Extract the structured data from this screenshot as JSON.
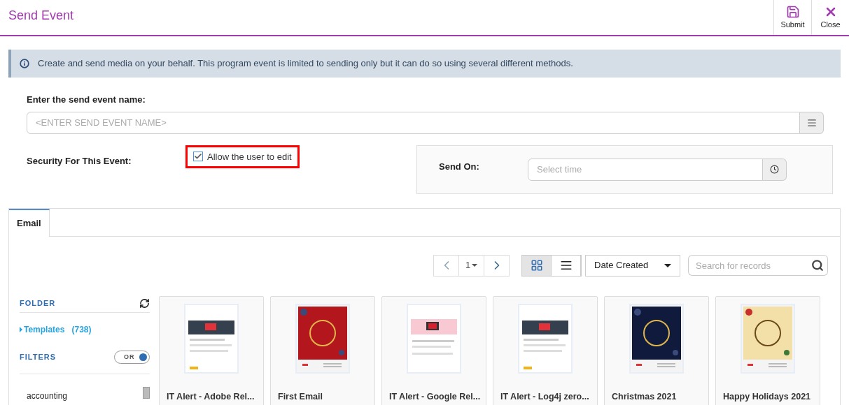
{
  "header": {
    "title": "Send Event",
    "actions": [
      {
        "kind": "save",
        "label": "Submit"
      },
      {
        "kind": "close",
        "label": "Close"
      }
    ]
  },
  "info": "Create and send media on your behalf. This program event is limited to sending only but it can do so using several different methods.",
  "name_field": {
    "label": "Enter the send event name:",
    "placeholder": "<ENTER SEND EVENT NAME>"
  },
  "security": {
    "label": "Security For This Event:",
    "checkbox": {
      "label": "Allow the user to edit",
      "checked": true,
      "highlighted": true
    }
  },
  "send_on": {
    "label": "Send On:",
    "placeholder": "Select time"
  },
  "tabs": [
    {
      "label": "Email",
      "selected": true
    }
  ],
  "toolbar": {
    "page": "1",
    "views": [
      {
        "kind": "grid",
        "selected": true
      },
      {
        "kind": "list",
        "selected": false
      }
    ],
    "sort": "Date Created",
    "search_placeholder": "Search for records"
  },
  "sidebar": {
    "folder_heading": "FOLDER",
    "folders": [
      {
        "label": "Templates",
        "count": "(738)",
        "expanded": false
      }
    ],
    "filters_heading": "FILTERS",
    "filter_mode": {
      "label": "OR",
      "on": true
    },
    "filters": [
      "accounting"
    ]
  },
  "cards": [
    {
      "title": "IT Alert - Adobe Rel..."
    },
    {
      "title": "First Email"
    },
    {
      "title": "IT Alert - Google Rel..."
    },
    {
      "title": "IT Alert - Log4j zero..."
    },
    {
      "title": "Christmas 2021"
    },
    {
      "title": "Happy Holidays 2021"
    }
  ]
}
